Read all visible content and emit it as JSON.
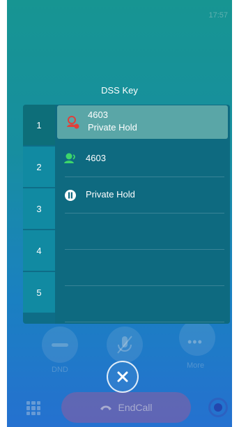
{
  "status_bar": {
    "time": "17:57"
  },
  "panel": {
    "title": "DSS Key",
    "tabs": [
      "1",
      "2",
      "3",
      "4",
      "5"
    ],
    "active_tab": "1",
    "rows": [
      {
        "line1": "4603",
        "line2": "Private Hold",
        "icon": "contact-alert-icon"
      },
      {
        "line1": "4603",
        "line2": "",
        "icon": "contact-online-icon"
      },
      {
        "line1": "Private Hold",
        "line2": "",
        "icon": "pause-icon"
      }
    ]
  },
  "background_controls": {
    "dnd_label": "DND",
    "more_label": "More",
    "end_call_label": "EndCall"
  },
  "colors": {
    "accent_highlight": "#5aa6a7",
    "panel_bg": "#0e6a80",
    "tab_bg": "#118aa2",
    "alert_icon": "#e0403a",
    "online_icon": "#3dd66a"
  }
}
